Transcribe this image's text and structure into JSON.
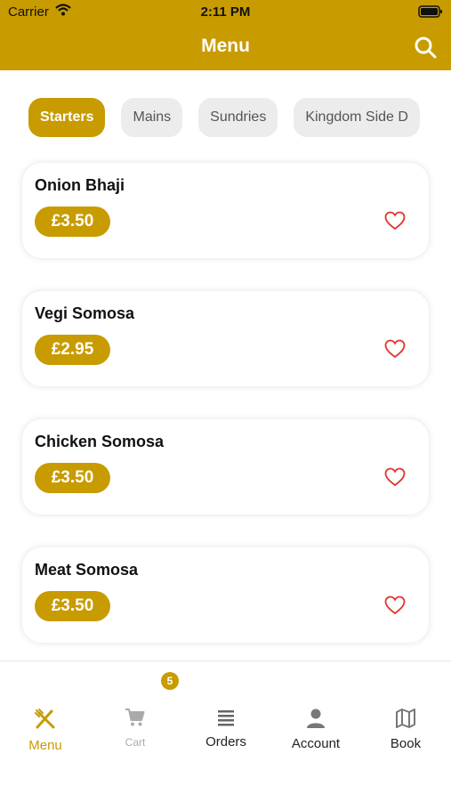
{
  "status_bar": {
    "carrier": "Carrier",
    "time": "2:11 PM"
  },
  "header": {
    "title": "Menu"
  },
  "tabs": [
    {
      "label": "Starters",
      "active": true
    },
    {
      "label": "Mains",
      "active": false
    },
    {
      "label": "Sundries",
      "active": false
    },
    {
      "label": "Kingdom Side D",
      "active": false
    }
  ],
  "items": [
    {
      "name": "Onion Bhaji",
      "price": "£3.50"
    },
    {
      "name": "Vegi Somosa",
      "price": "£2.95"
    },
    {
      "name": "Chicken Somosa",
      "price": "£3.50"
    },
    {
      "name": "Meat Somosa",
      "price": "£3.50"
    }
  ],
  "bottom_nav": {
    "cart_badge": "5",
    "items": [
      {
        "label": "Menu",
        "icon": "cutlery-icon"
      },
      {
        "label": "Cart",
        "icon": "cart-icon"
      },
      {
        "label": "Orders",
        "icon": "list-icon"
      },
      {
        "label": "Account",
        "icon": "person-icon"
      },
      {
        "label": "Book",
        "icon": "map-icon"
      }
    ]
  },
  "colors": {
    "accent": "#c89b00",
    "heart": "#e0342b",
    "background": "#ffffff"
  }
}
